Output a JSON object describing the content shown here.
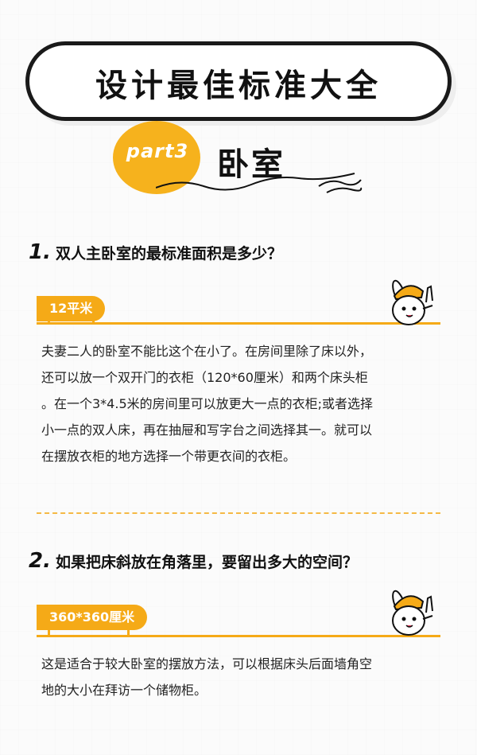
{
  "header": {
    "title": "设计最佳标准大全",
    "part_label": "part3",
    "part_name": "卧室"
  },
  "sections": [
    {
      "number": "1.",
      "question": "双人主卧室的最标准面积是多少？",
      "tag": "12平米",
      "lines": [
        "夫妻二人的卧室不能比这个在小了。在房间里除了床以外，",
        "还可以放一个双开门的衣柜（120*60厘米）和两个床头柜",
        "。在一个3*4.5米的房间里可以放更大一点的衣柜;或者选择",
        "小一点的双人床，再在抽屉和写字台之间选择其一。就可以",
        "在摆放衣柜的地方选择一个带更衣间的衣柜。"
      ]
    },
    {
      "number": "2.",
      "question": "如果把床斜放在角落里，要留出多大的空间？",
      "tag": "360*360厘米",
      "lines": [
        "这是适合于较大卧室的摆放方法，可以根据床头后面墙角空",
        "地的大小在拜访一个储物柜。"
      ]
    }
  ],
  "colors": {
    "accent": "#f5aa17",
    "text": "#222222",
    "outline": "#1a1a1a"
  },
  "icons": [
    "rabbit-mascot-icon",
    "wave-decoration-icon"
  ]
}
